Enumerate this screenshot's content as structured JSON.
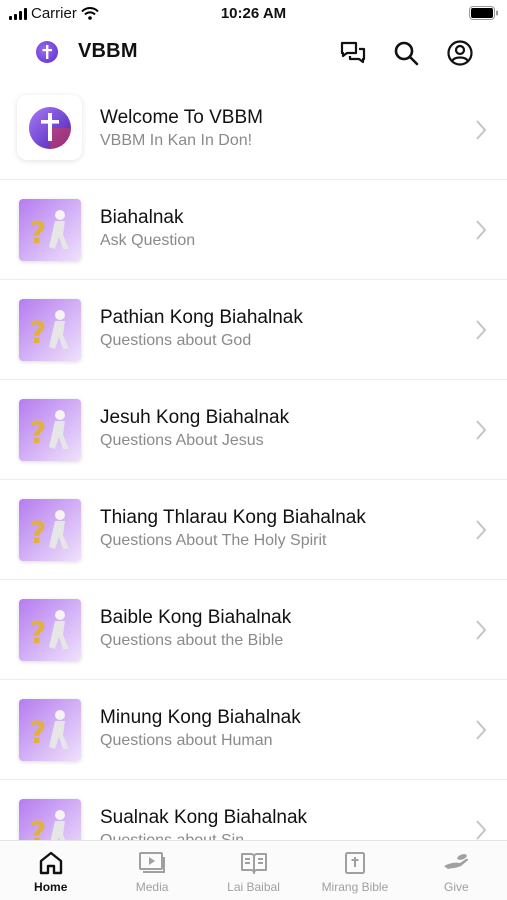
{
  "status_bar": {
    "carrier": "Carrier",
    "time": "10:26 AM"
  },
  "header": {
    "title": "VBBM",
    "icons": [
      "chat-icon",
      "search-icon",
      "profile-icon"
    ]
  },
  "list": [
    {
      "title": "Welcome To VBBM",
      "subtitle": "VBBM In Kan In Don!",
      "thumb": "vbbm-logo"
    },
    {
      "title": "Biahalnak",
      "subtitle": "Ask Question",
      "thumb": "question-figure"
    },
    {
      "title": "Pathian Kong Biahalnak",
      "subtitle": "Questions about God",
      "thumb": "question-figure"
    },
    {
      "title": "Jesuh Kong Biahalnak",
      "subtitle": "Questions About Jesus",
      "thumb": "question-figure"
    },
    {
      "title": "Thiang Thlarau Kong Biahalnak",
      "subtitle": "Questions About The Holy Spirit",
      "thumb": "question-figure"
    },
    {
      "title": "Baible Kong Biahalnak",
      "subtitle": "Questions about the Bible",
      "thumb": "question-figure"
    },
    {
      "title": "Minung Kong Biahalnak",
      "subtitle": "Questions about Human",
      "thumb": "question-figure"
    },
    {
      "title": "Sualnak Kong Biahalnak",
      "subtitle": "Questions about Sin",
      "thumb": "question-figure"
    }
  ],
  "tabs": [
    {
      "label": "Home",
      "icon": "home-icon",
      "active": true
    },
    {
      "label": "Media",
      "icon": "media-icon",
      "active": false
    },
    {
      "label": "Lai Baibal",
      "icon": "book-icon",
      "active": false
    },
    {
      "label": "Mirang Bible",
      "icon": "bible-icon",
      "active": false
    },
    {
      "label": "Give",
      "icon": "give-icon",
      "active": false
    }
  ],
  "colors": {
    "accent": "#7b4ce0",
    "thumb_gradient_start": "#b57cf0",
    "thumb_gradient_end": "#efe2fb",
    "subtitle": "#8a8a8a",
    "tab_inactive": "#a0a0a0"
  }
}
